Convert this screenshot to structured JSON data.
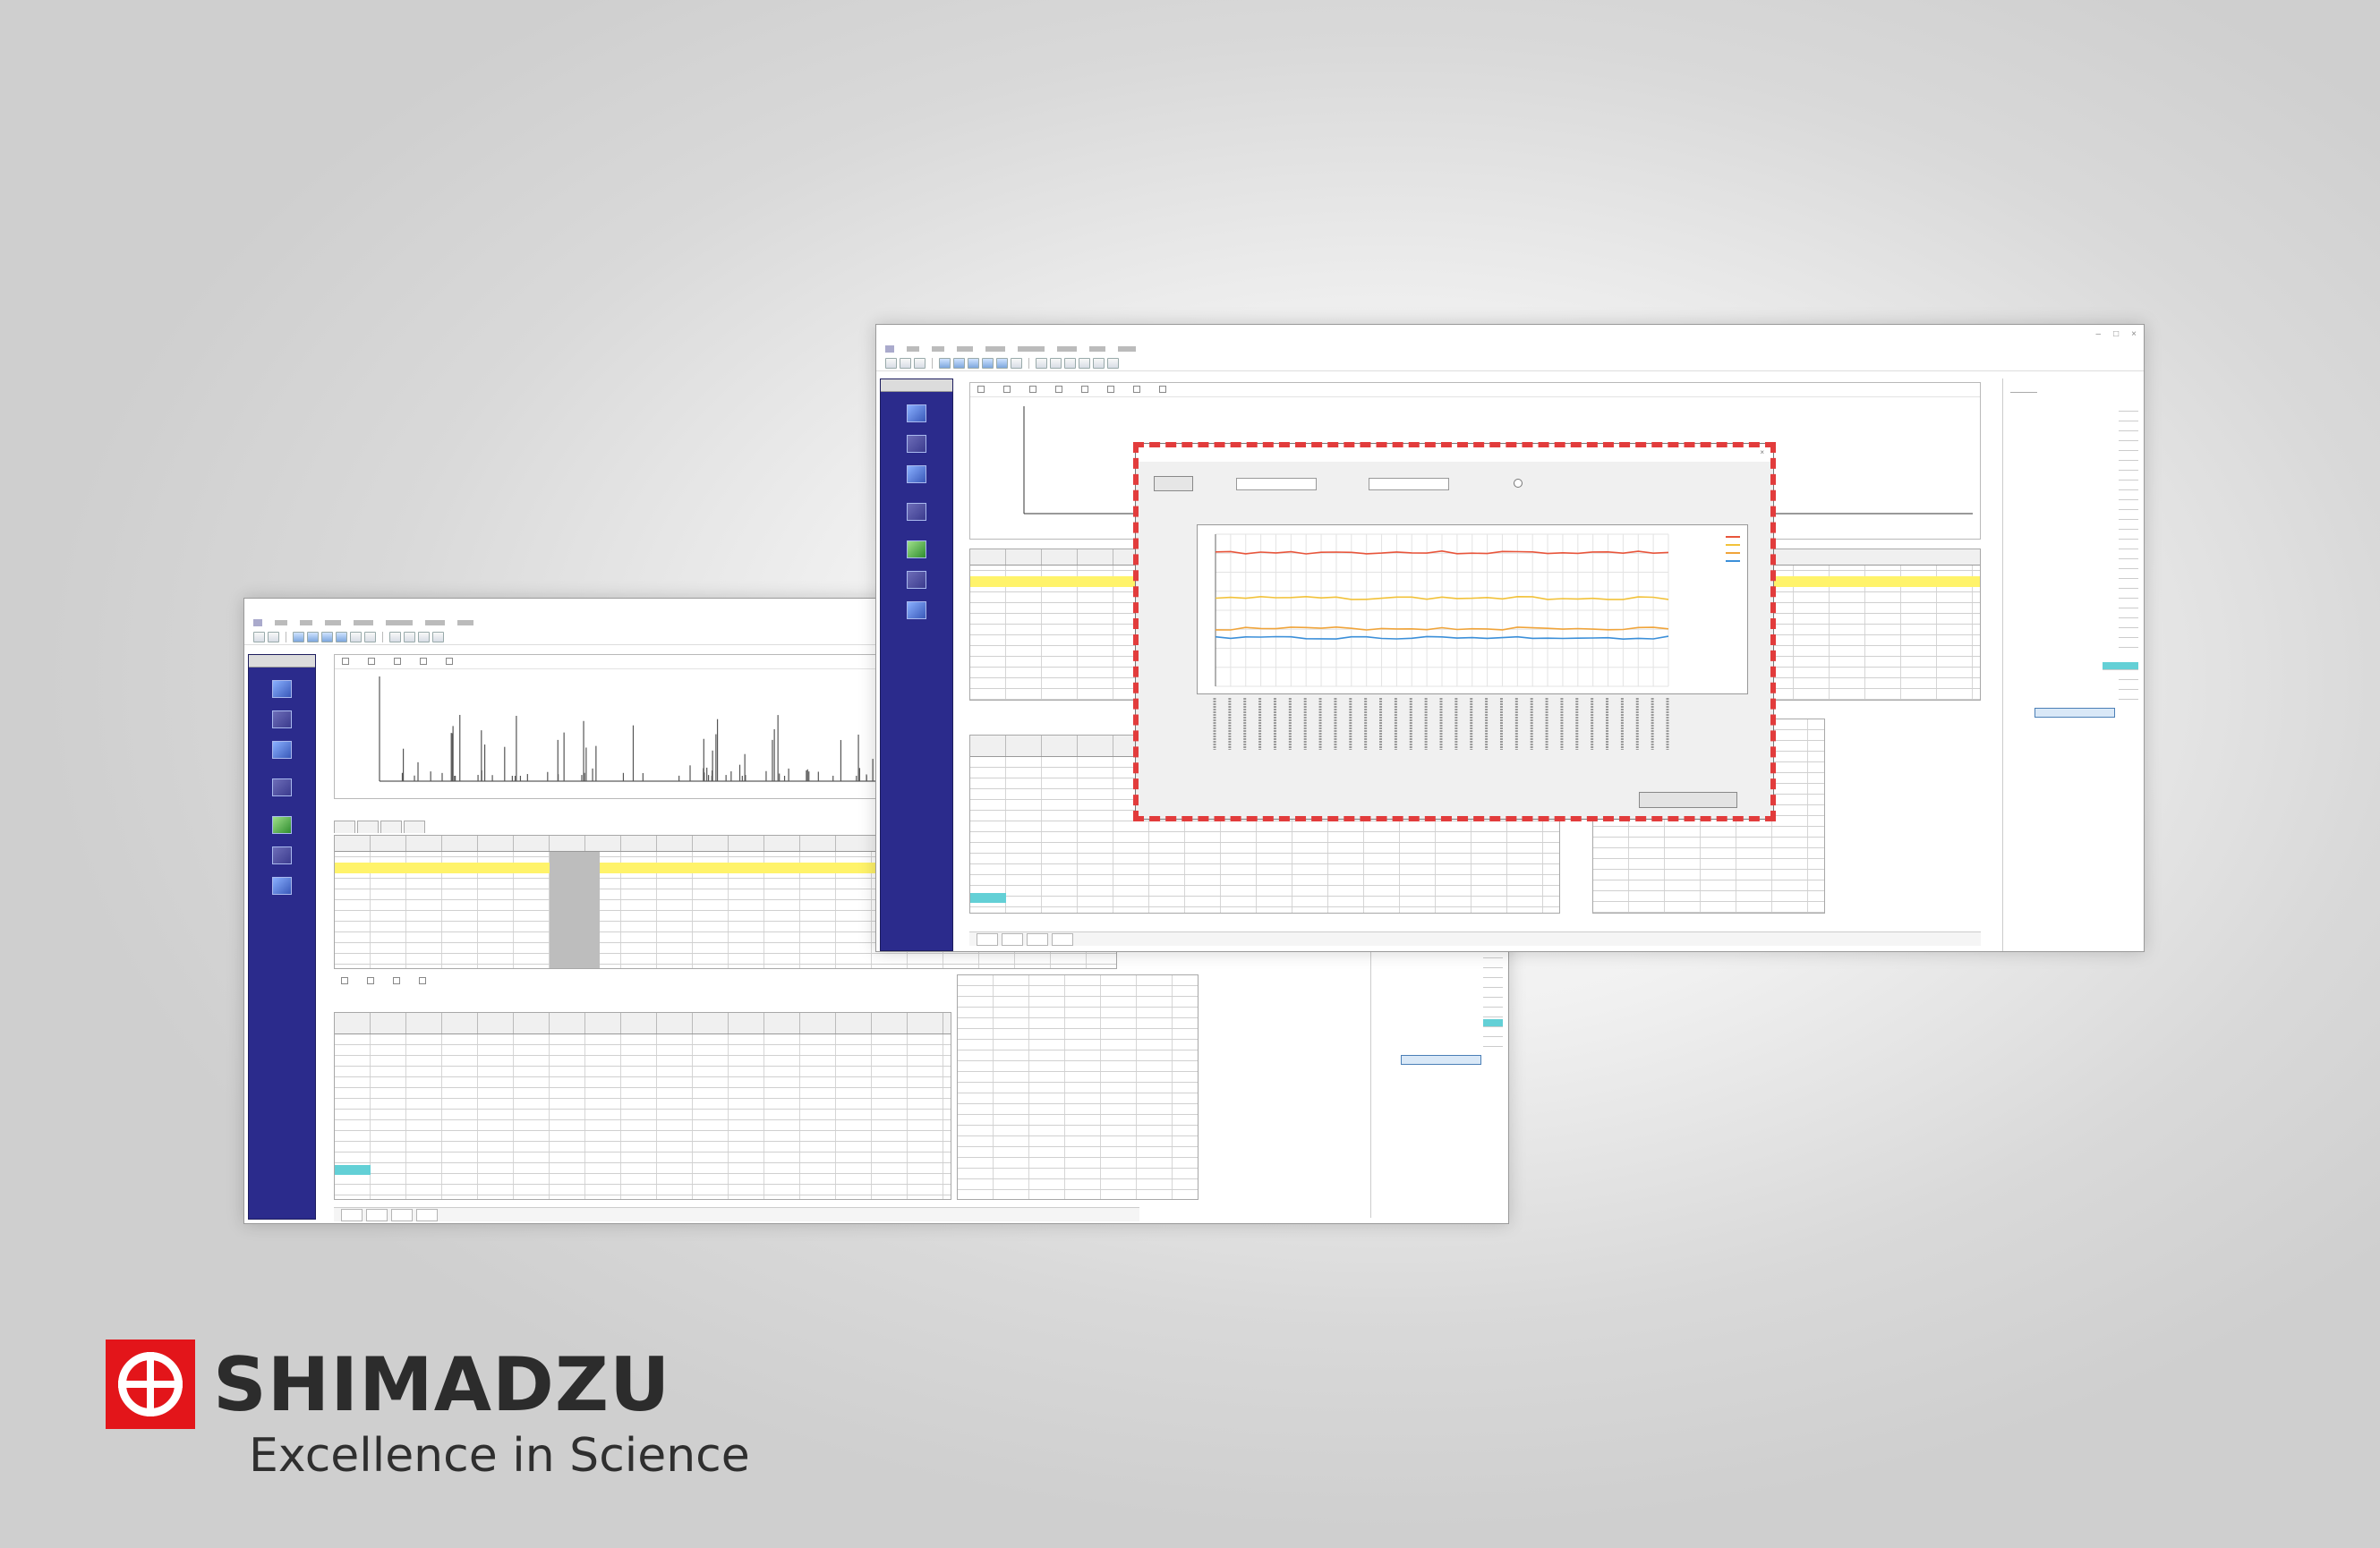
{
  "brand": {
    "name": "SHIMADZU",
    "tagline": "Excellence in Science",
    "logo_icon": "shimadzu-cross-circle-logo",
    "logo_color": "#e3151a"
  },
  "highlight_color": "#e23c3c",
  "plot_series_colors": [
    "#e8553b",
    "#f2c23a",
    "#f0a43a",
    "#3b8fd9"
  ],
  "table_highlight_color": "#fff36a",
  "nav_panel_color": "#2b2b8c",
  "selected_cell_color": "#63d0d6"
}
